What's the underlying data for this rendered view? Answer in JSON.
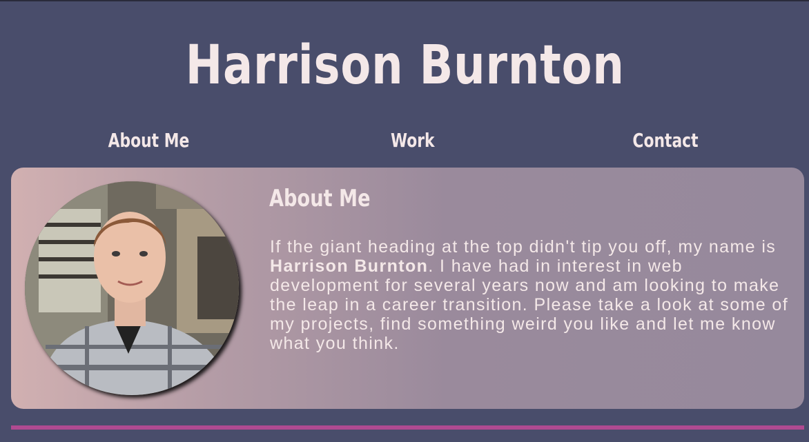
{
  "header": {
    "title": "Harrison Burnton"
  },
  "nav": {
    "items": [
      {
        "label": "About Me"
      },
      {
        "label": "Work"
      },
      {
        "label": "Contact"
      }
    ]
  },
  "about": {
    "heading": "About Me",
    "text_before": "If the giant heading at the top didn't tip you off, my name is ",
    "name_bold": "Harrison Burnton",
    "text_after": ". I have had in interest in web development for several years now and am looking to make the leap in a career transition. Please take a look at some of my projects, find something weird you like and let me know what you think.",
    "avatar_icon": "profile-photo"
  },
  "colors": {
    "background": "#494d6b",
    "text": "#f4e8e8",
    "divider": "#b04a91",
    "card_gradient_start": "#d1b0b1",
    "card_gradient_end": "#96899c"
  }
}
